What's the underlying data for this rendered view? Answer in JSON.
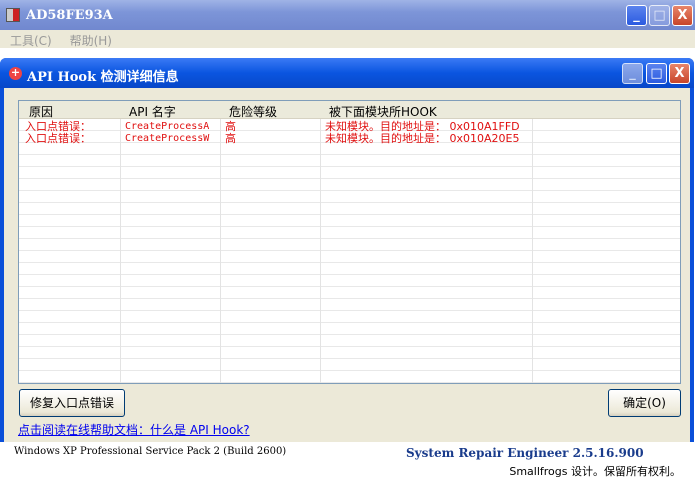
{
  "window": {
    "title": "AD58FE93A"
  },
  "menu": [
    {
      "label": "工具(C)"
    },
    {
      "label": "帮助(H)"
    }
  ],
  "dialog": {
    "title": "API Hook 检测详细信息",
    "columns": [
      "原因",
      "API 名字",
      "危险等级",
      "被下面模块所HOOK"
    ],
    "rows": [
      {
        "reason": "入口点错误：",
        "api": "CreateProcessA",
        "level": "高",
        "module": "未知模块。目的地址是： 0x010A1FFD"
      },
      {
        "reason": "入口点错误：",
        "api": "CreateProcessW",
        "level": "高",
        "module": "未知模块。目的地址是： 0x010A20E5"
      }
    ],
    "fix_button": "修复入口点错误",
    "ok_button": "确定(O)",
    "help_link": "点击阅读在线帮助文档：什么是 API Hook?"
  },
  "footer": {
    "os": "Windows XP Professional Service Pack 2 (Build 2600)",
    "product": "System Repair Engineer 2.5.16.900",
    "copyright": "Smallfrogs 设计。保留所有权利。"
  }
}
